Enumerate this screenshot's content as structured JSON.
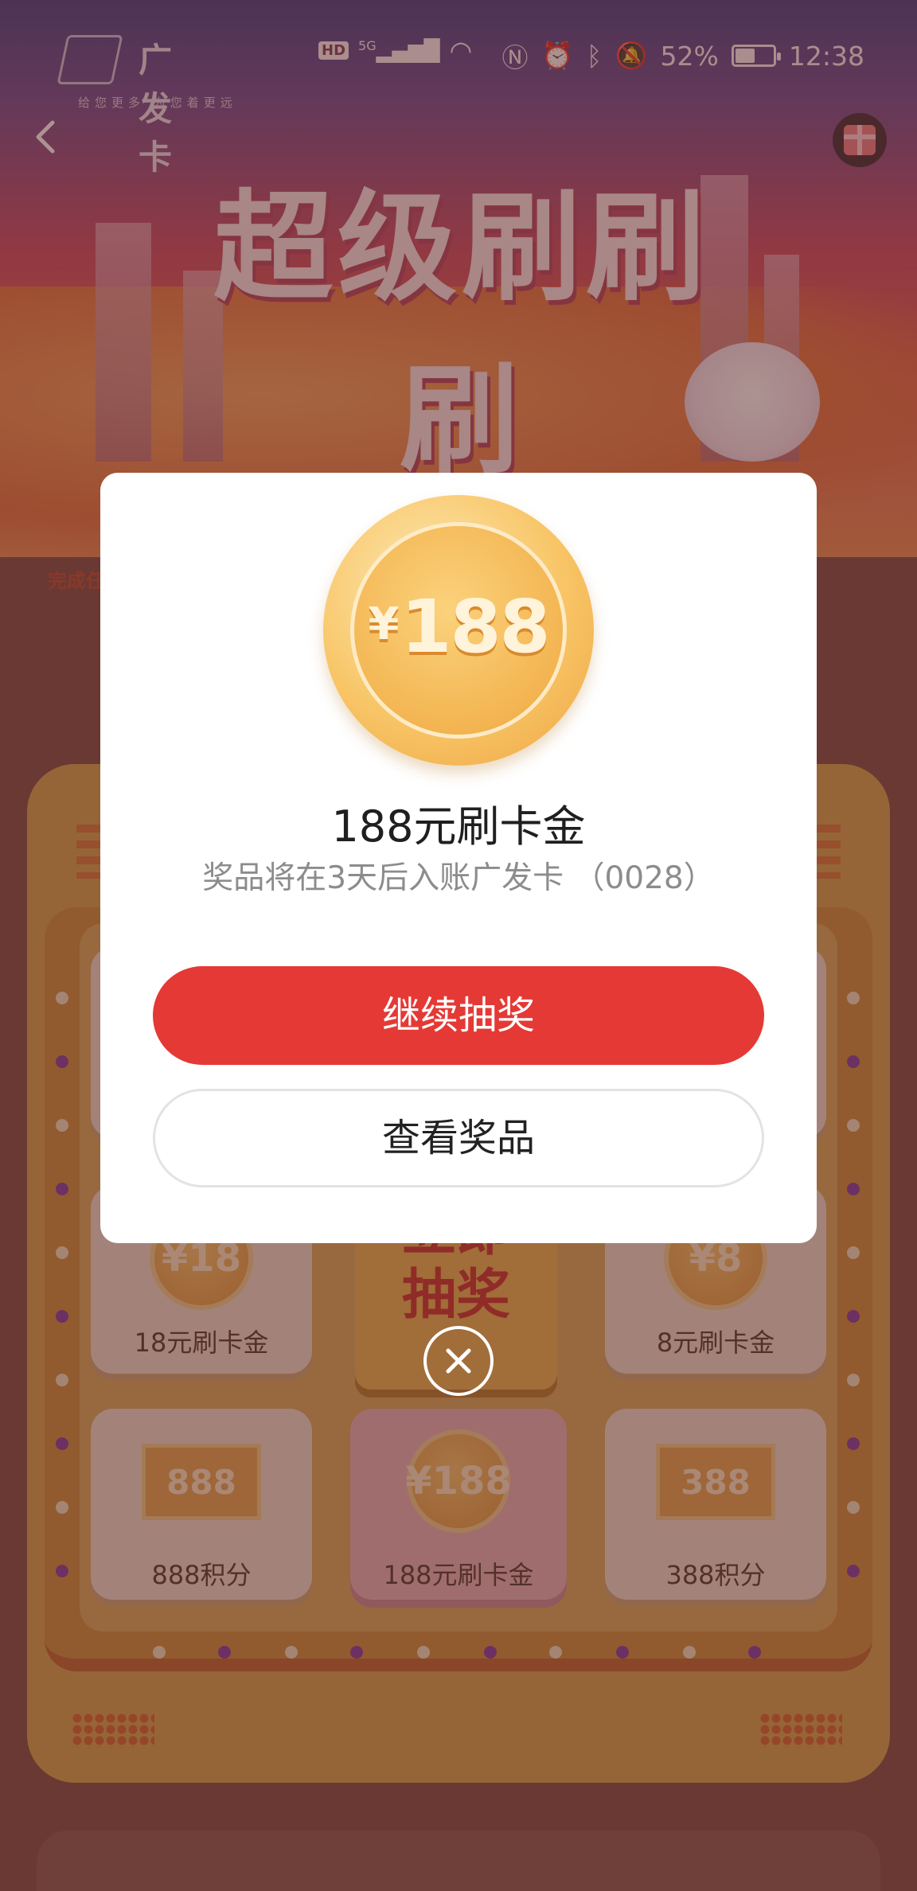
{
  "status_bar": {
    "network_badge": "HD",
    "network_type": "5G",
    "battery_percent": "52%",
    "battery_level": 0.52,
    "time": "12:38",
    "icons": [
      "hd-icon",
      "signal-icon",
      "wifi-icon",
      "nfc-icon",
      "alarm-icon",
      "bluetooth-icon",
      "mute-icon",
      "battery-icon"
    ]
  },
  "banner": {
    "brand_name": "广发卡",
    "brand_slogan": "给您更多 为您着更远",
    "title": "超级刷刷刷",
    "task_hint": "完成任"
  },
  "lottery_grid": {
    "center_button": [
      "立即",
      "抽奖"
    ],
    "prizes": [
      {
        "label": "18元刷卡金",
        "coin_text": "¥18",
        "kind": "coin"
      },
      {
        "label": "8元刷卡金",
        "coin_text": "¥8",
        "kind": "coin"
      },
      {
        "label": "888积分",
        "coin_text": "888",
        "kind": "note"
      },
      {
        "label": "188元刷卡金",
        "coin_text": "¥188",
        "kind": "coin",
        "selected": true
      },
      {
        "label": "388积分",
        "coin_text": "388",
        "kind": "note"
      }
    ]
  },
  "modal": {
    "coin_currency": "¥",
    "coin_value": "188",
    "title": "188元刷卡金",
    "subtitle": "奖品将在3天后入账广发卡 （0028）",
    "primary_button": "继续抽奖",
    "secondary_button": "查看奖品"
  },
  "colors": {
    "primary_button": "#e53935",
    "coin_gold": "#f3b552",
    "overlay": "#5a2823"
  }
}
